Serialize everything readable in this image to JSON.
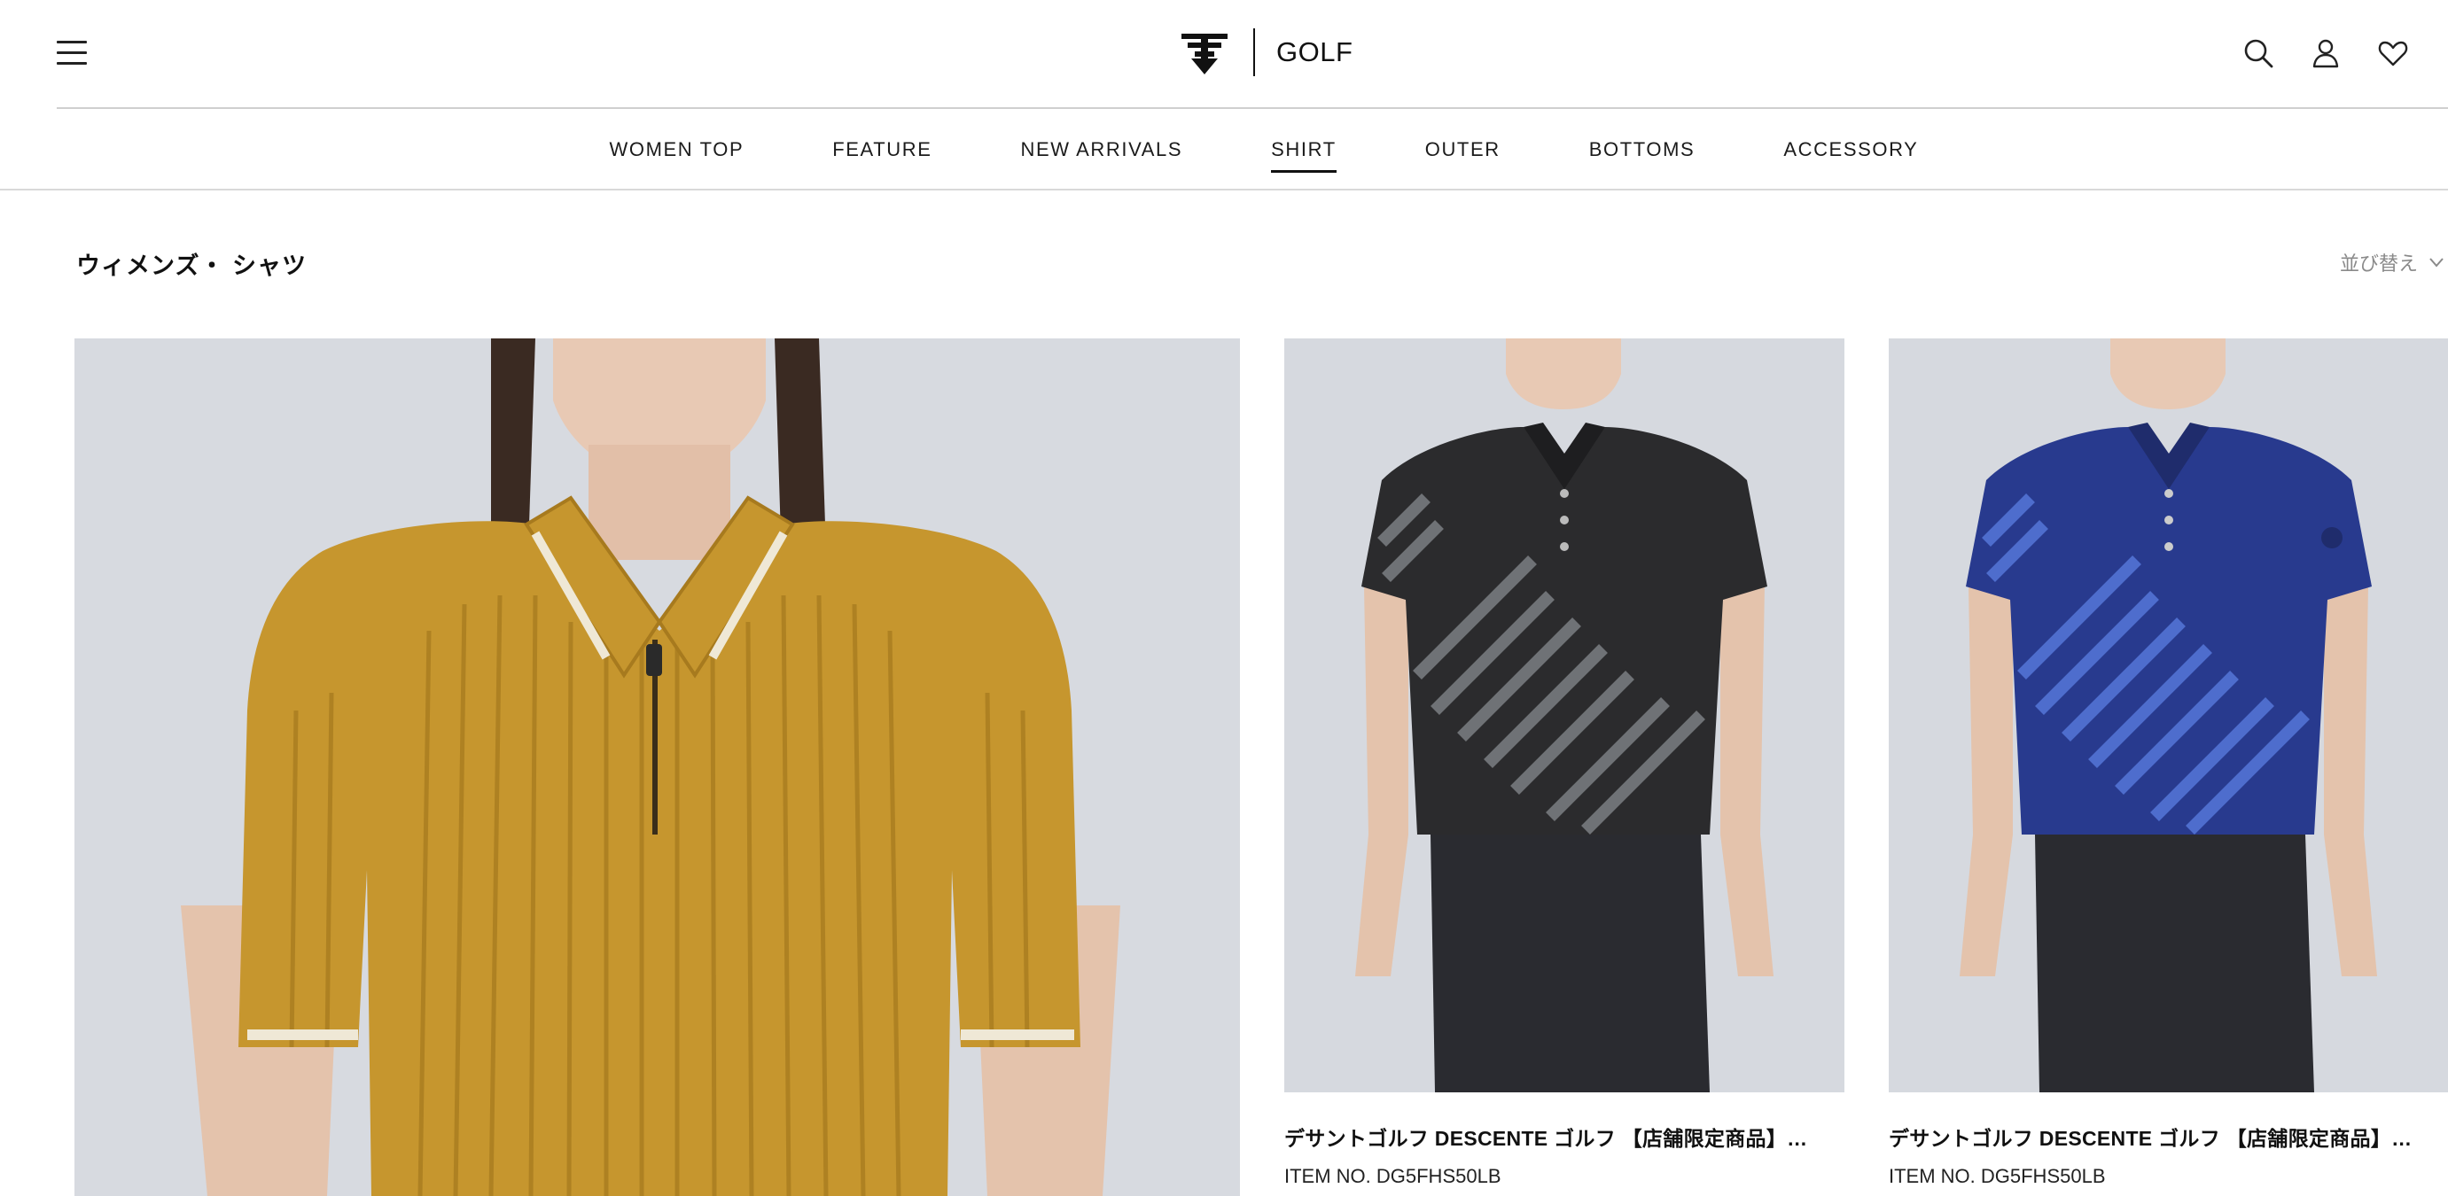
{
  "header": {
    "logo_text": "GOLF",
    "icons": [
      "menu-icon",
      "descente-logo-icon",
      "search-icon",
      "account-icon",
      "heart-icon"
    ]
  },
  "category_nav": {
    "items": [
      "WOMEN TOP",
      "FEATURE",
      "NEW ARRIVALS",
      "SHIRT",
      "OUTER",
      "BOTTOMS",
      "ACCESSORY"
    ],
    "active": "SHIRT"
  },
  "page": {
    "title": "ウィメンズ・ シャツ",
    "sort_label": "並び替え"
  },
  "products": [
    {
      "name": "",
      "item_no": "",
      "color": "#c6962e"
    },
    {
      "name": "デサントゴルフ DESCENTE ゴルフ 【店舗限定商品】…",
      "item_no": "ITEM NO. DG5FHS50LB",
      "color": "#2b2b2d"
    },
    {
      "name": "デサントゴルフ DESCENTE ゴルフ 【店舗限定商品】…",
      "item_no": "ITEM NO. DG5FHS50LB",
      "color": "#283a8e"
    }
  ],
  "colors": {
    "background": "#ffffff",
    "text": "#111111",
    "divider": "#cfcfcf",
    "image_bg": "#d6d9df"
  }
}
